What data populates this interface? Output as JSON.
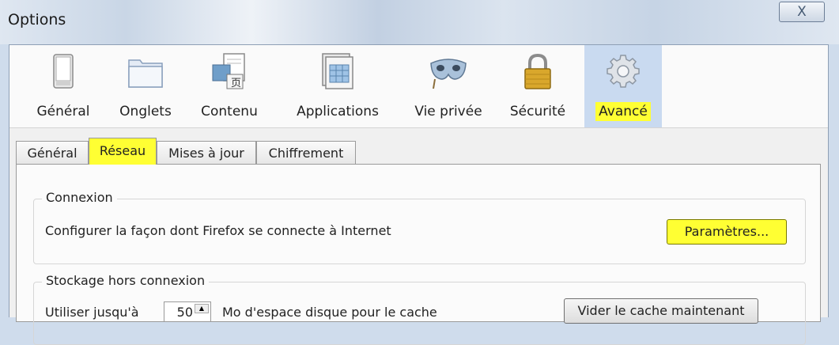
{
  "window": {
    "title": "Options",
    "close_label": "X"
  },
  "toolbar": {
    "items": [
      {
        "label": "Général",
        "icon": "switch-icon"
      },
      {
        "label": "Onglets",
        "icon": "tabs-icon"
      },
      {
        "label": "Contenu",
        "icon": "content-icon"
      },
      {
        "label": "Applications",
        "icon": "applications-icon"
      },
      {
        "label": "Vie privée",
        "icon": "mask-icon"
      },
      {
        "label": "Sécurité",
        "icon": "padlock-icon"
      },
      {
        "label": "Avancé",
        "icon": "gear-icon"
      }
    ],
    "active": "Avancé"
  },
  "tabs": {
    "items": [
      "Général",
      "Réseau",
      "Mises à jour",
      "Chiffrement"
    ],
    "selected": "Réseau"
  },
  "connexion": {
    "title": "Connexion",
    "description": "Configurer la façon dont Firefox se connecte à Internet",
    "settings_button": "Paramètres..."
  },
  "offline": {
    "title": "Stockage hors connexion",
    "use_prefix": "Utiliser jusqu'à",
    "cache_value": "50",
    "use_suffix": "Mo d'espace disque pour le cache",
    "clear_button": "Vider le cache maintenant"
  },
  "colors": {
    "highlight": "#ffff33",
    "active_toolbar": "#c9daf0"
  }
}
